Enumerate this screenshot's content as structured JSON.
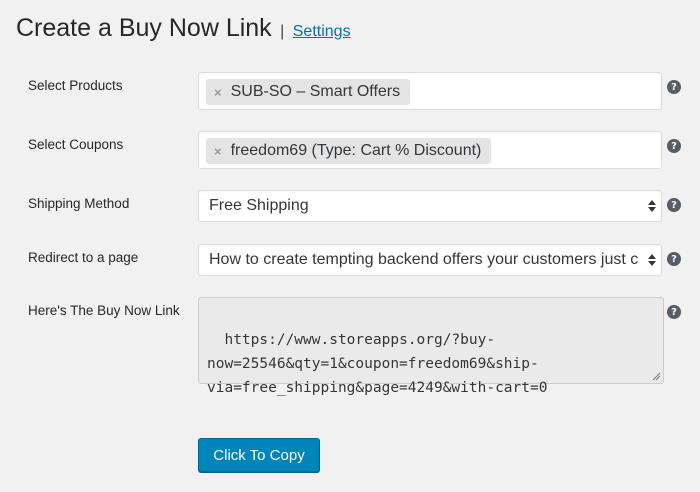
{
  "header": {
    "title": "Create a Buy Now Link",
    "separator": "|",
    "settings_link": "Settings"
  },
  "form": {
    "products": {
      "label": "Select Products",
      "selected": [
        "SUB-SO – Smart Offers"
      ]
    },
    "coupons": {
      "label": "Select Coupons",
      "selected": [
        "freedom69 (Type: Cart % Discount)"
      ]
    },
    "shipping": {
      "label": "Shipping Method",
      "value": "Free Shipping"
    },
    "redirect": {
      "label": "Redirect to a page",
      "value": "How to create tempting backend offers your customers just can't resist"
    },
    "link": {
      "label": "Here's The Buy Now Link",
      "value": "https://www.storeapps.org/?buy-\nnow=25546&qty=1&coupon=freedom69&ship-\nvia=free_shipping&page=4249&with-cart=0"
    },
    "copy_button": "Click To Copy",
    "help_glyph": "?",
    "remove_glyph": "×"
  },
  "colors": {
    "background": "#f1f1f1",
    "accent": "#0085ba",
    "link": "#0073aa"
  }
}
